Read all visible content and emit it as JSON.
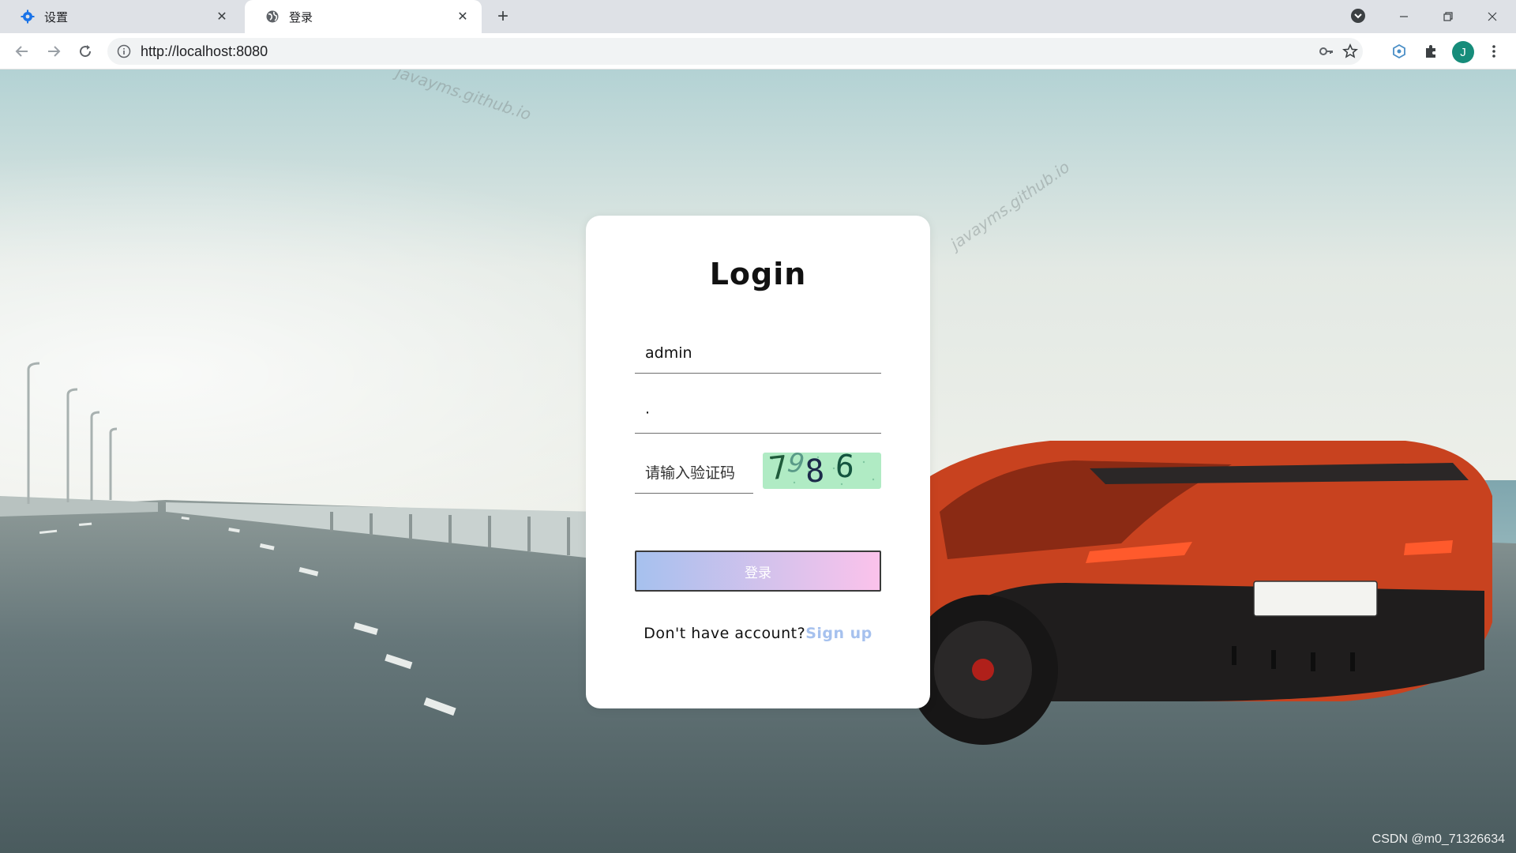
{
  "browser": {
    "tabs": [
      {
        "title": "设置",
        "icon": "gear-icon"
      },
      {
        "title": "登录",
        "icon": "globe-icon"
      }
    ],
    "url": "http://localhost:8080",
    "profile_initial": "J"
  },
  "page": {
    "watermark": "javayms.github.io",
    "credit": "CSDN @m0_71326634"
  },
  "login": {
    "title": "Login",
    "username_value": "admin",
    "password_value": "·",
    "captcha_placeholder": "请输入验证码",
    "captcha_chars": [
      "7",
      "9",
      "8",
      "6"
    ],
    "submit_label": "登录",
    "signup_prompt": "Don't have account?",
    "signup_link": "Sign up"
  },
  "colors": {
    "button_gradient_start": "#a6c1ee",
    "button_gradient_end": "#fbc2eb",
    "captcha_bg": "#b0ebc4",
    "link": "#a6c1ee"
  }
}
